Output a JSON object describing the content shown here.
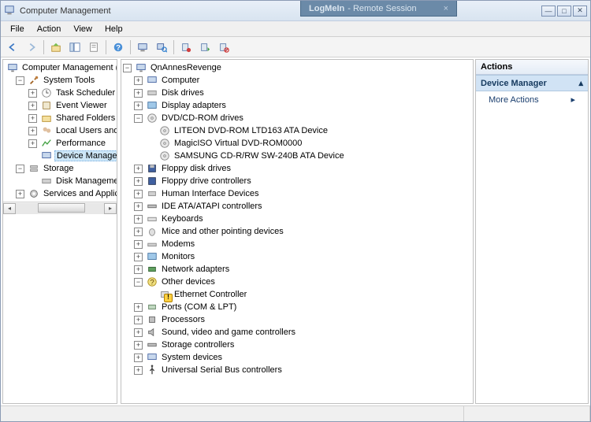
{
  "window": {
    "title": "Computer Management",
    "remote_badge": {
      "product": "LogMeIn",
      "label": " - Remote Session"
    }
  },
  "menus": {
    "file": "File",
    "action": "Action",
    "view": "View",
    "help": "Help"
  },
  "left_tree": {
    "root": "Computer Management (Local)",
    "system_tools": "System Tools",
    "task_scheduler": "Task Scheduler",
    "event_viewer": "Event Viewer",
    "shared_folders": "Shared Folders",
    "local_users": "Local Users and Groups",
    "performance": "Performance",
    "device_manager": "Device Manager",
    "storage": "Storage",
    "disk_management": "Disk Management",
    "services_apps": "Services and Applications"
  },
  "center_tree": {
    "root": "QnAnnesRevenge",
    "computer": "Computer",
    "disk_drives": "Disk drives",
    "display_adapters": "Display adapters",
    "dvd_cd": "DVD/CD-ROM drives",
    "dvd_children": {
      "liteon": "LITEON DVD-ROM LTD163 ATA Device",
      "magiciso": "MagicISO Virtual DVD-ROM0000",
      "samsung": "SAMSUNG CD-R/RW SW-240B ATA Device"
    },
    "floppy_drives": "Floppy disk drives",
    "floppy_controllers": "Floppy drive controllers",
    "hid": "Human Interface Devices",
    "ide": "IDE ATA/ATAPI controllers",
    "keyboards": "Keyboards",
    "mice": "Mice and other pointing devices",
    "modems": "Modems",
    "monitors": "Monitors",
    "network": "Network adapters",
    "other": "Other devices",
    "other_children": {
      "ethernet": "Ethernet Controller"
    },
    "ports": "Ports (COM & LPT)",
    "processors": "Processors",
    "sound": "Sound, video and game controllers",
    "storage_ctrl": "Storage controllers",
    "system": "System devices",
    "usb": "Universal Serial Bus controllers"
  },
  "actions": {
    "header": "Actions",
    "section": "Device Manager",
    "more": "More Actions"
  }
}
